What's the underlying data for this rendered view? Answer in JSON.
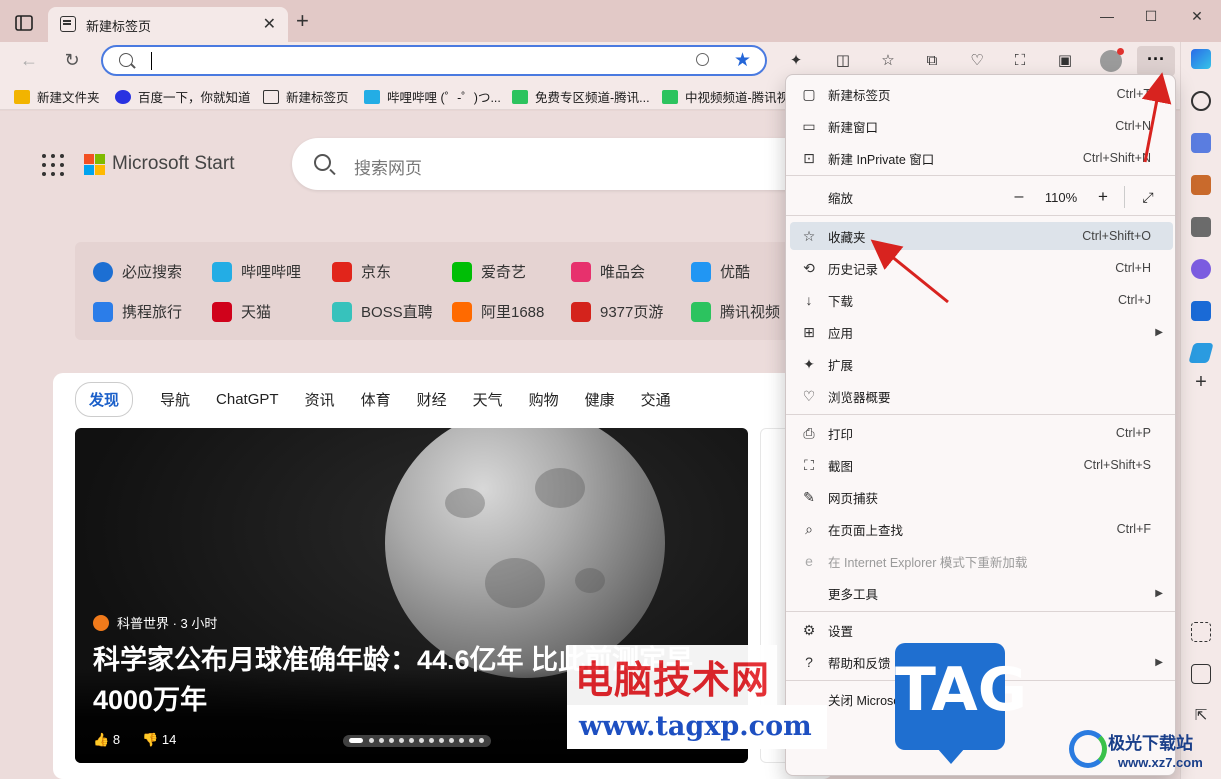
{
  "tab": {
    "title": "新建标签页"
  },
  "favorites": [
    {
      "label": "新建文件夹",
      "icon": "folder-icon",
      "color": "#f2b400"
    },
    {
      "label": "百度一下，你就知道",
      "icon": "baidu-icon",
      "color": "#2932e1"
    },
    {
      "label": "新建标签页",
      "icon": "newtab-icon",
      "color": "#333333"
    },
    {
      "label": "哔哩哔哩 (゜-゜)つ...",
      "icon": "bilibili-icon",
      "color": "#23ade5"
    },
    {
      "label": "免费专区频道-腾讯...",
      "icon": "tencent-video-icon",
      "color": "#2cc35f"
    },
    {
      "label": "中视频频道-腾讯视...",
      "icon": "tencent-video-icon",
      "color": "#2cc35f"
    }
  ],
  "start": {
    "brand": "Microsoft Start",
    "search_placeholder": "搜索网页"
  },
  "sites": [
    {
      "label": "必应搜索",
      "color": "#1c6fd3"
    },
    {
      "label": "哔哩哔哩",
      "color": "#23ade5"
    },
    {
      "label": "京东",
      "color": "#e1251b"
    },
    {
      "label": "爱奇艺",
      "color": "#00be06"
    },
    {
      "label": "唯品会",
      "color": "#e7316d"
    },
    {
      "label": "优酷",
      "color": "#2196f3"
    },
    {
      "label": "携程旅行",
      "color": "#2b7de9"
    },
    {
      "label": "天猫",
      "color": "#d0021b"
    },
    {
      "label": "BOSS直聘",
      "color": "#37c2bc"
    },
    {
      "label": "阿里1688",
      "color": "#ff6a00"
    },
    {
      "label": "9377页游",
      "color": "#d4231c"
    },
    {
      "label": "腾讯视频",
      "color": "#2cc35f"
    }
  ],
  "feed_tabs": [
    "发现",
    "导航",
    "ChatGPT",
    "资讯",
    "体育",
    "财经",
    "天气",
    "购物",
    "健康",
    "交通"
  ],
  "article": {
    "source": "科普世界 · 3 小时",
    "headline": "科学家公布月球准确年龄：44.6亿年 比此前测定早4000万年",
    "likes": "8",
    "dislikes": "14"
  },
  "menu": {
    "items": [
      {
        "label": "新建标签页",
        "shortcut": "Ctrl+T",
        "icon": "new-tab-icon"
      },
      {
        "label": "新建窗口",
        "shortcut": "Ctrl+N",
        "icon": "new-window-icon"
      },
      {
        "label": "新建 InPrivate 窗口",
        "shortcut": "Ctrl+Shift+N",
        "icon": "inprivate-icon"
      },
      {
        "label": "缩放",
        "icon": "zoom-icon"
      },
      {
        "label": "收藏夹",
        "shortcut": "Ctrl+Shift+O",
        "icon": "favorites-icon"
      },
      {
        "label": "历史记录",
        "shortcut": "Ctrl+H",
        "icon": "history-icon"
      },
      {
        "label": "下载",
        "shortcut": "Ctrl+J",
        "icon": "download-icon"
      },
      {
        "label": "应用",
        "icon": "apps-icon"
      },
      {
        "label": "扩展",
        "icon": "extensions-icon"
      },
      {
        "label": "浏览器概要",
        "icon": "browser-essentials-icon"
      },
      {
        "label": "打印",
        "shortcut": "Ctrl+P",
        "icon": "print-icon"
      },
      {
        "label": "截图",
        "shortcut": "Ctrl+Shift+S",
        "icon": "screenshot-icon"
      },
      {
        "label": "网页捕获",
        "icon": "web-capture-icon"
      },
      {
        "label": "在页面上查找",
        "shortcut": "Ctrl+F",
        "icon": "find-icon"
      },
      {
        "label": "在 Internet Explorer 模式下重新加载",
        "icon": "ie-mode-icon"
      },
      {
        "label": "更多工具",
        "icon": "more-tools-icon"
      },
      {
        "label": "设置",
        "icon": "settings-icon"
      },
      {
        "label": "帮助和反馈",
        "icon": "help-icon"
      },
      {
        "label": "关闭 Microsoft Edge",
        "icon": "close-edge-icon"
      }
    ],
    "zoom_value": "110%",
    "zoom_minus": "–",
    "zoom_plus": "+"
  },
  "watermark": {
    "site_name": "电脑技术网",
    "url": "www.tagxp.com",
    "badge": "TAG",
    "brand2": "极光下载站",
    "brand2_url": "www.xz7.com"
  },
  "feedback": "反馈"
}
